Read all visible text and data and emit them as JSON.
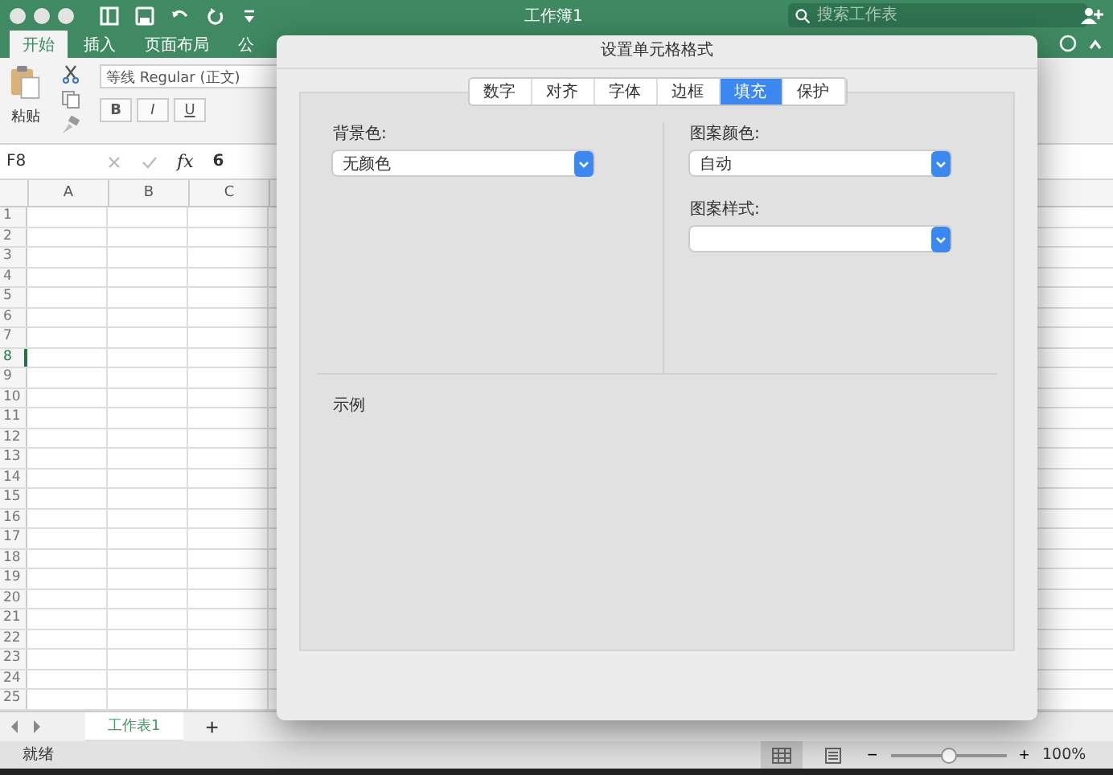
{
  "window": {
    "title": "工作簿1",
    "search": {
      "placeholder": "搜索工作表"
    }
  },
  "ribbon_tabs": [
    {
      "label": "开始",
      "selected": true
    },
    {
      "label": "插入",
      "selected": false
    },
    {
      "label": "页面布局",
      "selected": false
    },
    {
      "label": "公",
      "selected": false
    }
  ],
  "ribbon": {
    "paste_label": "粘贴",
    "font_name": "等线 Regular (正文)",
    "format_buttons": [
      "B",
      "I",
      "U"
    ]
  },
  "formula_bar": {
    "cell": "F8",
    "value": "6",
    "fx": "fx"
  },
  "columns": [
    "A",
    "B",
    "C"
  ],
  "rows": [
    {
      "label": "1",
      "selected": false
    },
    {
      "label": "2",
      "selected": false
    },
    {
      "label": "3",
      "selected": false
    },
    {
      "label": "4",
      "selected": false
    },
    {
      "label": "5",
      "selected": false
    },
    {
      "label": "6",
      "selected": false
    },
    {
      "label": "7",
      "selected": false
    },
    {
      "label": "8",
      "selected": true
    },
    {
      "label": "9",
      "selected": false
    },
    {
      "label": "10",
      "selected": false
    },
    {
      "label": "11",
      "selected": false
    },
    {
      "label": "12",
      "selected": false
    },
    {
      "label": "13",
      "selected": false
    },
    {
      "label": "14",
      "selected": false
    },
    {
      "label": "15",
      "selected": false
    },
    {
      "label": "16",
      "selected": false
    },
    {
      "label": "17",
      "selected": false
    },
    {
      "label": "18",
      "selected": false
    },
    {
      "label": "19",
      "selected": false
    },
    {
      "label": "20",
      "selected": false
    },
    {
      "label": "21",
      "selected": false
    },
    {
      "label": "22",
      "selected": false
    },
    {
      "label": "23",
      "selected": false
    },
    {
      "label": "24",
      "selected": false
    },
    {
      "label": "25",
      "selected": false
    }
  ],
  "sheet_tabs": [
    {
      "label": "工作表1",
      "selected": true
    }
  ],
  "add_sheet": "+",
  "status_bar": {
    "text": "就绪",
    "zoom_minus": "−",
    "zoom_plus": "+",
    "zoom": "100%",
    "zoom_slider": {
      "level": 0.5
    }
  },
  "dialog": {
    "title": "设置单元格格式",
    "tabs": [
      {
        "label": "数字",
        "selected": false
      },
      {
        "label": "对齐",
        "selected": false
      },
      {
        "label": "字体",
        "selected": false
      },
      {
        "label": "边框",
        "selected": false
      },
      {
        "label": "填充",
        "selected": true
      },
      {
        "label": "保护",
        "selected": false
      }
    ],
    "background": {
      "label": "背景色:",
      "value": "无颜色"
    },
    "pattern_color": {
      "label": "图案颜色:",
      "value": "自动"
    },
    "pattern_style": {
      "label": "图案样式:"
    },
    "sample": {
      "label": "示例"
    }
  }
}
